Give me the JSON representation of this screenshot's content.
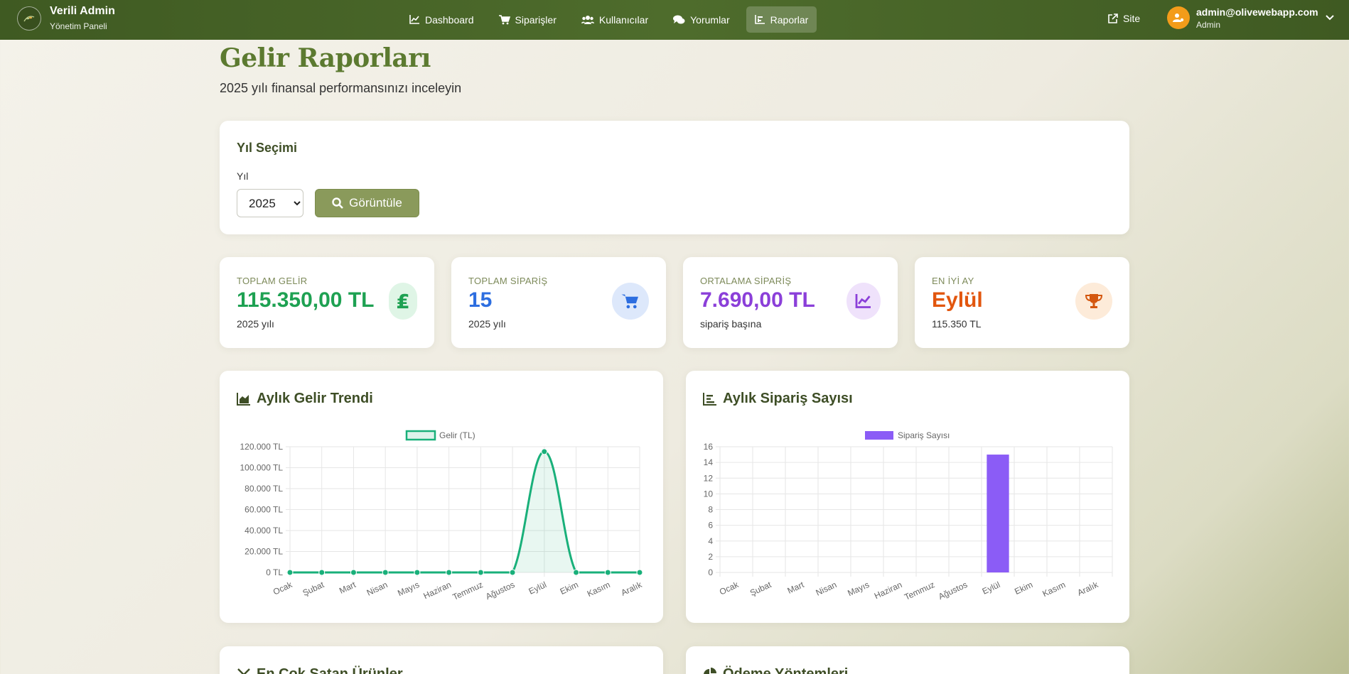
{
  "navbar": {
    "brand_title": "Verili Admin",
    "brand_subtitle": "Yönetim Paneli",
    "items": [
      {
        "label": "Dashboard",
        "icon": "chart-line-icon"
      },
      {
        "label": "Siparişler",
        "icon": "cart-icon"
      },
      {
        "label": "Kullanıcılar",
        "icon": "users-icon"
      },
      {
        "label": "Yorumlar",
        "icon": "comments-icon"
      },
      {
        "label": "Raporlar",
        "icon": "chart-bar-icon",
        "active": true
      }
    ],
    "site_label": "Site",
    "user_email": "admin@olivewebapp.com",
    "user_role": "Admin"
  },
  "header": {
    "title": "Gelir Raporları",
    "subtitle": "2025 yılı finansal performansınızı inceleyin"
  },
  "year_selection": {
    "title": "Yıl Seçimi",
    "label": "Yıl",
    "selected": "2025",
    "button_label": "Görüntüle"
  },
  "stats": [
    {
      "label": "TOPLAM GELİR",
      "value": "115.350,00 TL",
      "sub": "2025 yılı",
      "color": "#1ea152",
      "icon_bg": "#dff5e6"
    },
    {
      "label": "TOPLAM SİPARİŞ",
      "value": "15",
      "sub": "2025 yılı",
      "color": "#2d6ee0",
      "icon_bg": "#dde8fb"
    },
    {
      "label": "ORTALAMA SİPARİŞ",
      "value": "7.690,00 TL",
      "sub": "sipariş başına",
      "color": "#8b3fd9",
      "icon_bg": "#efe2fb"
    },
    {
      "label": "EN İYİ AY",
      "value": "Eylül",
      "sub": "115.350 TL",
      "color": "#e2560e",
      "icon_bg": "#fdebd9"
    }
  ],
  "revenue_chart": {
    "title": "Aylık Gelir Trendi",
    "chart_data": {
      "type": "line",
      "categories": [
        "Ocak",
        "Şubat",
        "Mart",
        "Nisan",
        "Mayıs",
        "Haziran",
        "Temmuz",
        "Ağustos",
        "Eylül",
        "Ekim",
        "Kasım",
        "Aralık"
      ],
      "series": [
        {
          "name": "Gelir (TL)",
          "values": [
            0,
            0,
            0,
            0,
            0,
            0,
            0,
            0,
            115350,
            0,
            0,
            0
          ]
        }
      ],
      "yticks": [
        "0 TL",
        "20.000 TL",
        "40.000 TL",
        "60.000 TL",
        "80.000 TL",
        "100.000 TL",
        "120.000 TL"
      ],
      "ylim": [
        0,
        120000
      ],
      "grid": true,
      "legend": "top",
      "color": "#19b07a"
    }
  },
  "orders_chart": {
    "title": "Aylık Sipariş Sayısı",
    "chart_data": {
      "type": "bar",
      "categories": [
        "Ocak",
        "Şubat",
        "Mart",
        "Nisan",
        "Mayıs",
        "Haziran",
        "Temmuz",
        "Ağustos",
        "Eylül",
        "Ekim",
        "Kasım",
        "Aralık"
      ],
      "series": [
        {
          "name": "Sipariş Sayısı",
          "values": [
            0,
            0,
            0,
            0,
            0,
            0,
            0,
            0,
            15,
            0,
            0,
            0
          ]
        }
      ],
      "yticks": [
        "0",
        "2",
        "4",
        "6",
        "8",
        "10",
        "12",
        "14",
        "16"
      ],
      "ylim": [
        0,
        16
      ],
      "grid": true,
      "legend": "top",
      "color": "#8b5cf6"
    }
  },
  "bottom_cards": [
    {
      "title": "En Çok Satan Ürünler",
      "icon": "award-icon"
    },
    {
      "title": "Ödeme Yöntemleri",
      "icon": "pie-chart-icon"
    }
  ]
}
